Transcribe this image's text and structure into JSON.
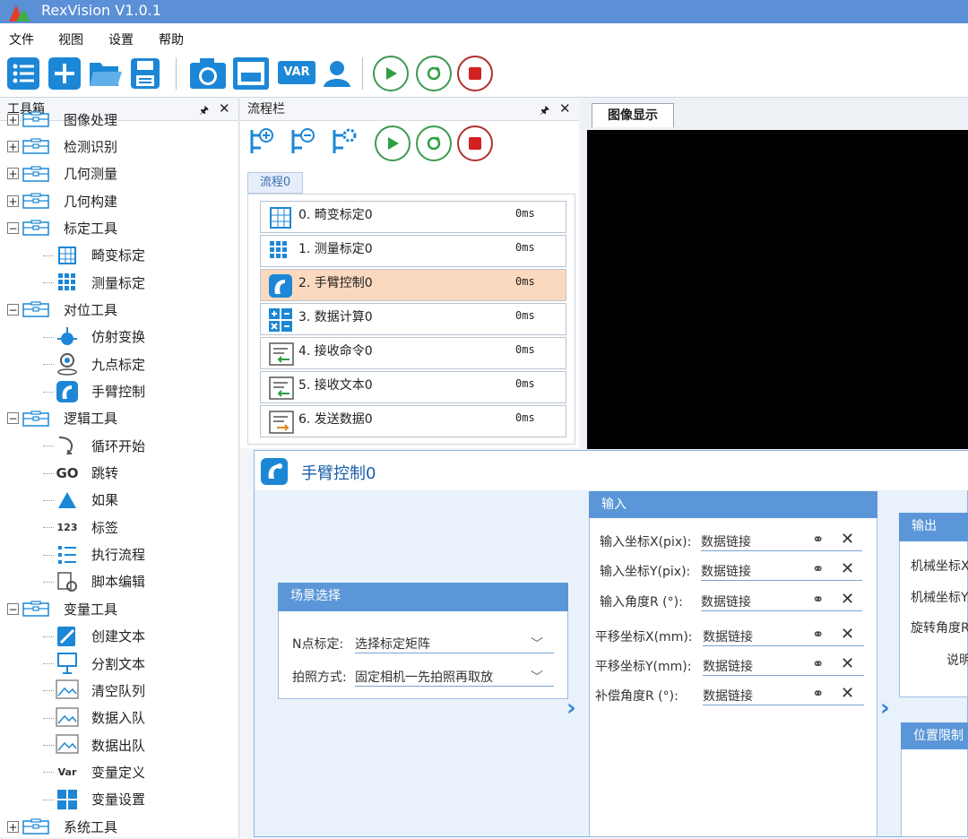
{
  "window": {
    "title": "RexVision V1.0.1"
  },
  "menu": [
    "文件",
    "视图",
    "设置",
    "帮助"
  ],
  "toolbar": {
    "var_label": "VAR"
  },
  "toolbox": {
    "title": "工具箱",
    "tree": [
      {
        "label": "图像处理",
        "type": "group",
        "expander": "+"
      },
      {
        "label": "检测识别",
        "type": "group",
        "expander": "+"
      },
      {
        "label": "几何测量",
        "type": "group",
        "expander": "+"
      },
      {
        "label": "几何构建",
        "type": "group",
        "expander": "+"
      },
      {
        "label": "标定工具",
        "type": "group",
        "expander": "-"
      },
      {
        "label": "畸变标定",
        "type": "leaf"
      },
      {
        "label": "测量标定",
        "type": "leaf"
      },
      {
        "label": "对位工具",
        "type": "group",
        "expander": "-"
      },
      {
        "label": "仿射变换",
        "type": "leaf"
      },
      {
        "label": "九点标定",
        "type": "leaf"
      },
      {
        "label": "手臂控制",
        "type": "leaf"
      },
      {
        "label": "逻辑工具",
        "type": "group",
        "expander": "-"
      },
      {
        "label": "循环开始",
        "type": "leaf"
      },
      {
        "label": "跳转",
        "type": "leaf"
      },
      {
        "label": "如果",
        "type": "leaf"
      },
      {
        "label": "标签",
        "type": "leaf"
      },
      {
        "label": "执行流程",
        "type": "leaf"
      },
      {
        "label": "脚本编辑",
        "type": "leaf"
      },
      {
        "label": "变量工具",
        "type": "group",
        "expander": "-"
      },
      {
        "label": "创建文本",
        "type": "leaf"
      },
      {
        "label": "分割文本",
        "type": "leaf"
      },
      {
        "label": "清空队列",
        "type": "leaf"
      },
      {
        "label": "数据入队",
        "type": "leaf"
      },
      {
        "label": "数据出队",
        "type": "leaf"
      },
      {
        "label": "变量定义",
        "type": "leaf"
      },
      {
        "label": "变量设置",
        "type": "leaf"
      },
      {
        "label": "系统工具",
        "type": "group",
        "expander": "+"
      }
    ],
    "icon_labels": {
      "go": "GO",
      "num": "123",
      "var": "Var"
    }
  },
  "flowbar": {
    "title": "流程栏",
    "tab": "流程0",
    "rows": [
      {
        "name": "0. 畸变标定0",
        "time": "0ms",
        "icon": "grid-distort-icon"
      },
      {
        "name": "1. 测量标定0",
        "time": "0ms",
        "icon": "dot-grid-icon"
      },
      {
        "name": "2. 手臂控制0",
        "time": "0ms",
        "icon": "robot-arm-icon",
        "selected": true
      },
      {
        "name": "3. 数据计算0",
        "time": "0ms",
        "icon": "calculator-icon"
      },
      {
        "name": "4. 接收命令0",
        "time": "0ms",
        "icon": "receive-icon"
      },
      {
        "name": "5. 接收文本0",
        "time": "0ms",
        "icon": "receive-text-icon"
      },
      {
        "name": "6. 发送数据0",
        "time": "0ms",
        "icon": "send-icon"
      }
    ]
  },
  "image_display": {
    "tab": "图像显示"
  },
  "property": {
    "title": "手臂控制0",
    "scene": {
      "title": "场景选择",
      "fields": [
        {
          "label": "N点标定:",
          "value": "选择标定矩阵"
        },
        {
          "label": "拍照方式:",
          "value": "固定相机一先拍照再取放"
        }
      ]
    },
    "input": {
      "title": "输入",
      "fields": [
        {
          "label": "输入坐标X(pix):",
          "value": "数据链接"
        },
        {
          "label": "输入坐标Y(pix):",
          "value": "数据链接"
        },
        {
          "label": "输入角度R  (°):",
          "value": "数据链接"
        },
        {
          "label": "平移坐标X(mm):",
          "value": "数据链接"
        },
        {
          "label": "平移坐标Y(mm):",
          "value": "数据链接"
        },
        {
          "label": "补偿角度R  (°):",
          "value": "数据链接"
        }
      ]
    },
    "output": {
      "title": "输出",
      "fields": [
        "机械坐标X",
        "机械坐标Y",
        "旋转角度R",
        "说明"
      ]
    },
    "limit": {
      "title": "位置限制"
    }
  }
}
